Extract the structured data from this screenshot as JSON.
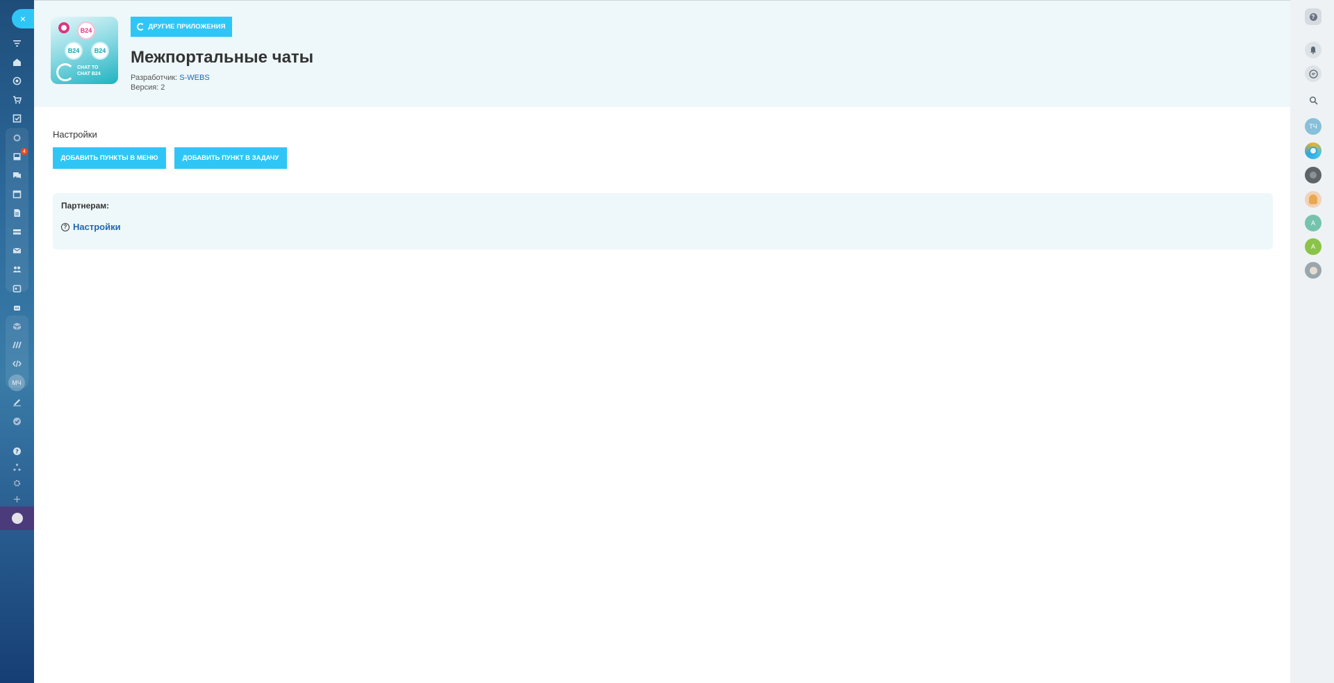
{
  "left_menu": {
    "close_label": "×",
    "badge_count": "4",
    "user_initials": "МЧ",
    "icons": [
      "filter-icon",
      "house-icon",
      "target-icon",
      "cart-icon",
      "checkbox-icon",
      "crm-icon",
      "inbox-icon",
      "chat-icon",
      "calendar-icon",
      "document-icon",
      "drive-icon",
      "mail-icon",
      "group-icon",
      "contact-center-icon",
      "robot-icon",
      "store-icon",
      "analytics-icon",
      "code-icon",
      "user-avatar",
      "pen-icon",
      "check-circle-icon",
      "help-icon",
      "sitemap-icon",
      "gear-icon",
      "plus-icon",
      "market-icon"
    ]
  },
  "right_bar": {
    "help_label": "?",
    "avatar_initials_1": "ТЧ",
    "avatar_initials_2": "А",
    "avatar_initials_3": "А",
    "colors": {
      "tch": "#88bfd9",
      "a1": "#76c3ad",
      "a2": "#8bc34a"
    }
  },
  "header": {
    "other_apps_label": "ДРУГИЕ ПРИЛОЖЕНИЯ",
    "title": "Межпортальные чаты",
    "developer_label": "Разработчик:",
    "developer_name": "S-WEBS",
    "version": "Версия: 2",
    "icon_caption_1": "CHAT TO",
    "icon_caption_2": "CHAT B24",
    "icon_b24": "B24"
  },
  "content": {
    "settings_label": "Настройки",
    "add_menu_button": "ДОБАВИТЬ ПУНКТЫ В МЕНЮ",
    "add_task_button": "ДОБАВИТЬ ПУНКТ В ЗАДАЧУ"
  },
  "partners": {
    "title": "Партнерам:",
    "link_label": "Настройки",
    "link_icon": "?"
  },
  "colors": {
    "accent": "#2fc6f6",
    "link": "#2067b0",
    "header_bg": "#eef7f9"
  }
}
